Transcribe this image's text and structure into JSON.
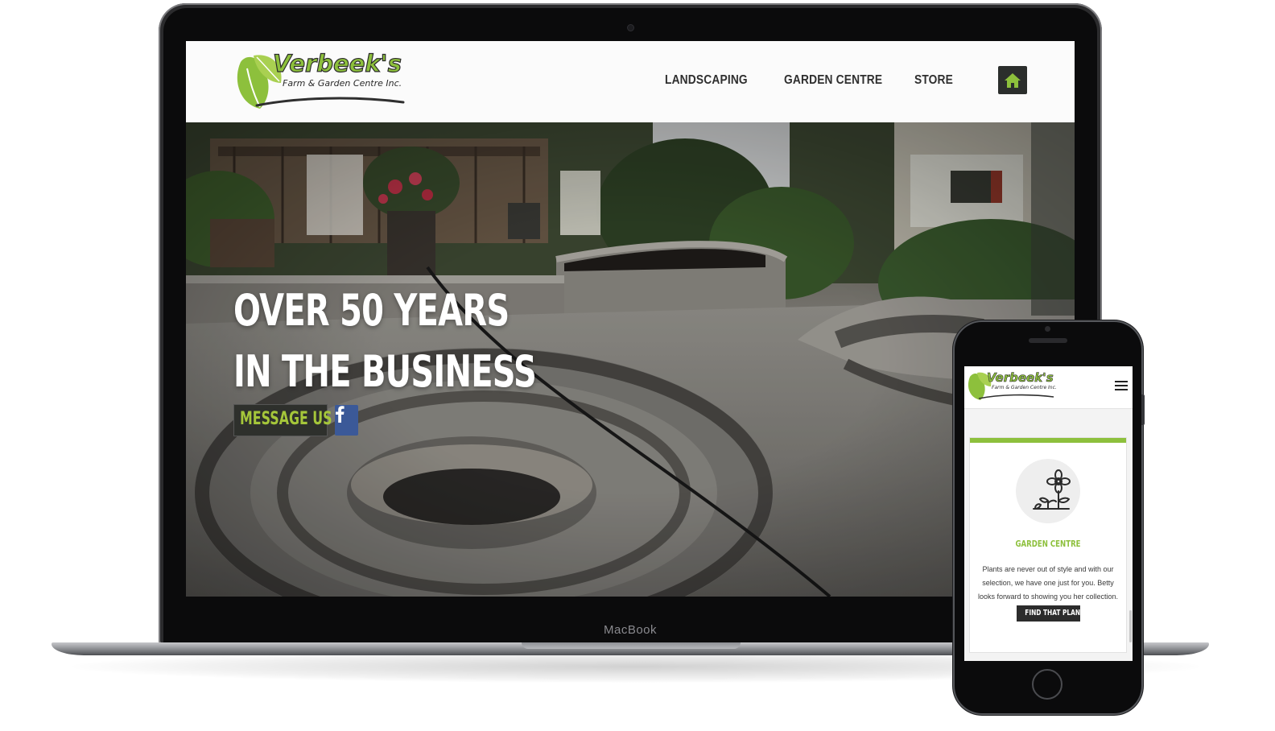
{
  "colors": {
    "brand_green": "#8dc03c",
    "button_dark": "#2e302c",
    "facebook_blue": "#3b5998",
    "device_black": "#0b0b0c"
  },
  "laptop": {
    "brand_label": "MacBook",
    "site": {
      "logo": {
        "name": "Verbeek's",
        "tagline": "Farm & Garden Centre Inc."
      },
      "nav": {
        "items": [
          "LANDSCAPING",
          "GARDEN CENTRE",
          "STORE"
        ],
        "home_icon": "home-icon"
      },
      "hero": {
        "title_line1": "OVER 50 YEARS",
        "title_line2": "IN THE BUSINESS",
        "cta_label": "MESSAGE US",
        "social_icon": "facebook-icon"
      }
    }
  },
  "phone": {
    "site": {
      "logo": {
        "name": "Verbeek's",
        "tagline": "Farm & Garden Centre Inc."
      },
      "menu_icon": "hamburger-menu-icon",
      "card": {
        "icon": "flower-plant-icon",
        "title": "GARDEN CENTRE",
        "text": "Plants are never out of style and with our selection, we have one just for you. Betty looks forward to showing you her collection.",
        "button_label": "FIND THAT PLANT"
      }
    }
  }
}
